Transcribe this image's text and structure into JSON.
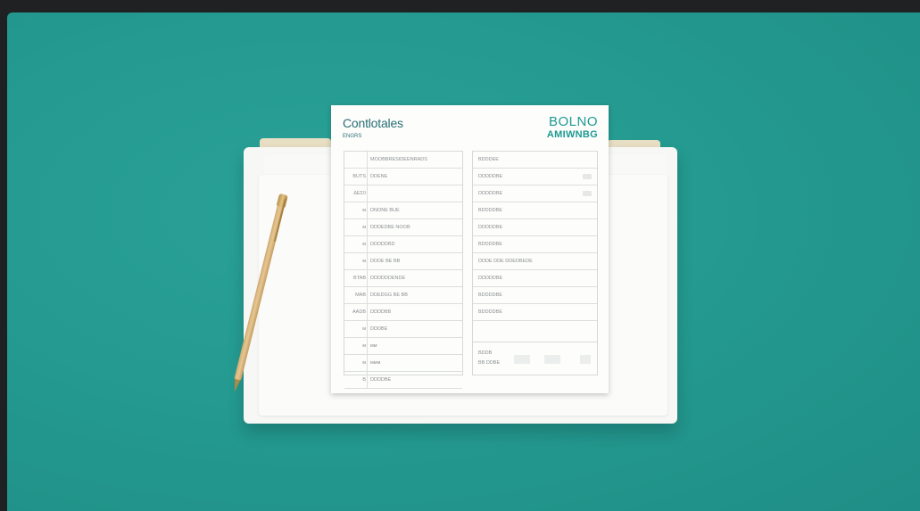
{
  "document": {
    "title": "Contlotales",
    "subtitle": "ENGRS",
    "brand_line1": "BOLNO",
    "brand_line2": "AMIWNBG"
  },
  "left_table": {
    "rows": [
      {
        "num": "",
        "text": "MOOBBRESIDEENRADS"
      },
      {
        "num": "BUTS",
        "text": "DDENE"
      },
      {
        "num": "ΔΕΣ0",
        "text": ""
      },
      {
        "num": "ᴍ",
        "text": "DNONE BUE"
      },
      {
        "num": "ᴍ",
        "text": "DDDEDBE NOOB"
      },
      {
        "num": "ᴍ",
        "text": "DDDDDBD"
      },
      {
        "num": "ᴍ",
        "text": "DDDE BE BB"
      },
      {
        "num": "BTAB",
        "text": "DDDDDDENDE"
      },
      {
        "num": "MAB",
        "text": "DDEDGG BE BB"
      },
      {
        "num": "AADB",
        "text": "DDDDBB"
      },
      {
        "num": "ᴍ",
        "text": "DDDBE"
      },
      {
        "num": "ᴍ",
        "text": "ᴍᴍ"
      },
      {
        "num": "ᴍ",
        "text": "ᴍᴍᴍ"
      },
      {
        "num": "B",
        "text": "DDDDBE"
      }
    ]
  },
  "right_table": {
    "header": "BDDDEE",
    "rows": [
      "DDDDDBE",
      "DDDDDBE",
      "BDDDDBE",
      "DDDDDBE",
      "BDDDDBE",
      "DDDE DDE DDEDBEDE",
      "DDDDDBE",
      "BDDDDBE",
      "BDDDDBE"
    ],
    "footer_line1": "BDDB",
    "footer_line2": "BB DDBE"
  },
  "colors": {
    "background": "#249a90",
    "accent": "#1e9a92",
    "paper": "#fdfdfc",
    "folder_tab": "#e8dfc4"
  }
}
